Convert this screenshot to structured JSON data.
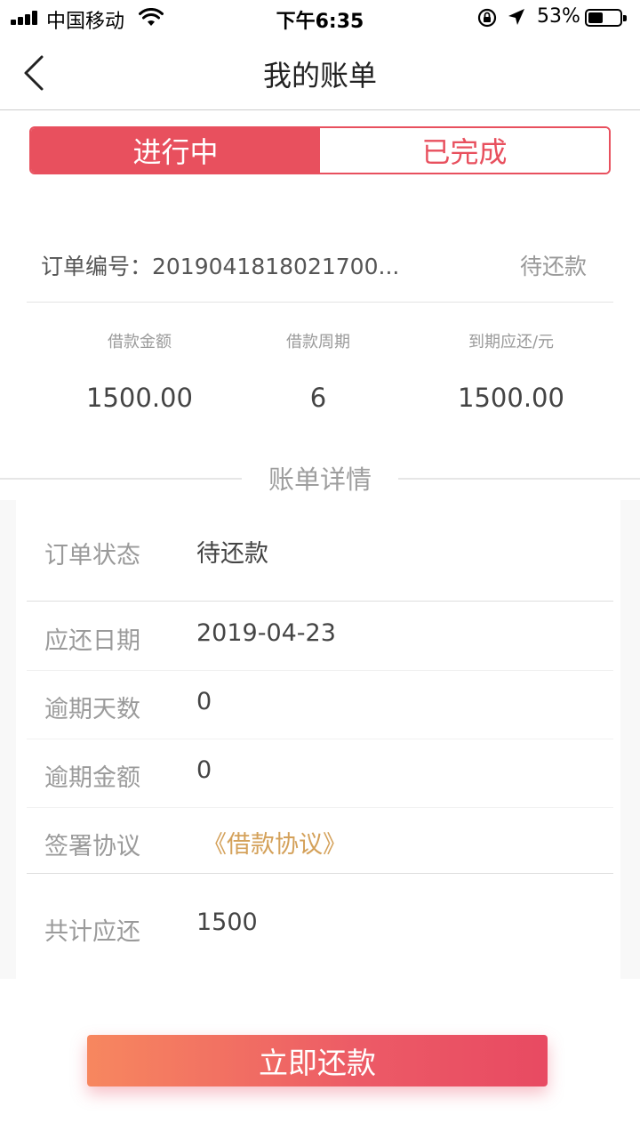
{
  "status_bar": {
    "carrier": "中国移动",
    "time": "下午6:35",
    "battery_pct": "53%",
    "battery_level": 0.53
  },
  "nav": {
    "title": "我的账单",
    "back_icon": "chevron-left-icon"
  },
  "tabs": [
    {
      "label": "进行中",
      "active": true
    },
    {
      "label": "已完成",
      "active": false
    }
  ],
  "order": {
    "number_label": "订单编号：2019041818021700...",
    "status": "待还款"
  },
  "stats": [
    {
      "label": "借款金额",
      "value": "1500.00"
    },
    {
      "label": "借款周期",
      "value": "6"
    },
    {
      "label": "到期应还/元",
      "value": "1500.00"
    }
  ],
  "detail": {
    "title": "账单详情",
    "rows": [
      {
        "key": "订单状态",
        "value": "待还款"
      },
      {
        "key": "应还日期",
        "value": "2019-04-23"
      },
      {
        "key": "逾期天数",
        "value": "0"
      },
      {
        "key": "逾期金额",
        "value": "0"
      },
      {
        "key": "签署协议",
        "value": "《借款协议》"
      },
      {
        "key": "共计应还",
        "value": "1500"
      }
    ]
  },
  "button": {
    "label": "立即还款"
  },
  "colors": {
    "accent": "#e8505e",
    "link": "#d4a15a",
    "button_gradient_start": "#f7875f",
    "button_gradient_end": "#e84a62"
  }
}
